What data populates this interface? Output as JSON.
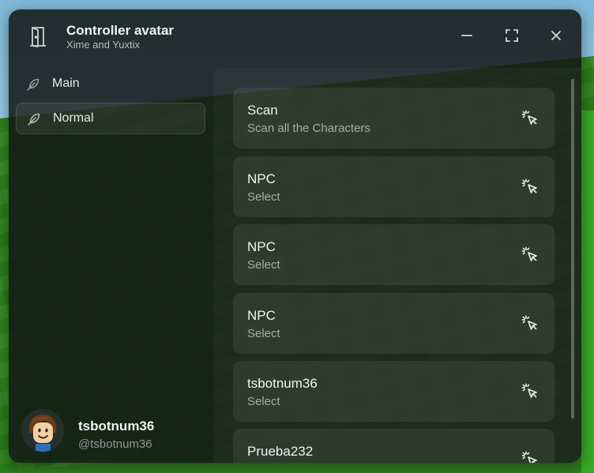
{
  "window": {
    "title": "Controller avatar",
    "subtitle": "Xime and Yuxtix"
  },
  "window_controls": {
    "icons": [
      "minimize-icon",
      "maximize-icon",
      "close-icon"
    ]
  },
  "sidebar": {
    "tabs": [
      {
        "label": "Main",
        "icon": "feather-icon",
        "active": false
      },
      {
        "label": "Normal",
        "icon": "feather-icon",
        "active": true
      }
    ]
  },
  "profile": {
    "display_name": "tsbotnum36",
    "username": "@tsbotnum36"
  },
  "buttons": [
    {
      "title": "Scan",
      "description": "Scan all the Characters",
      "icon": "cursor-click-icon"
    },
    {
      "title": "NPC",
      "description": "Select",
      "icon": "cursor-click-icon"
    },
    {
      "title": "NPC",
      "description": "Select",
      "icon": "cursor-click-icon"
    },
    {
      "title": "NPC",
      "description": "Select",
      "icon": "cursor-click-icon"
    },
    {
      "title": "tsbotnum36",
      "description": "Select",
      "icon": "cursor-click-icon"
    },
    {
      "title": "Prueba232",
      "description": "",
      "icon": "cursor-click-icon"
    }
  ],
  "colors": {
    "window_bg": "#121614",
    "ground": "#2f8a1c",
    "sky": "#a9d3ea"
  }
}
